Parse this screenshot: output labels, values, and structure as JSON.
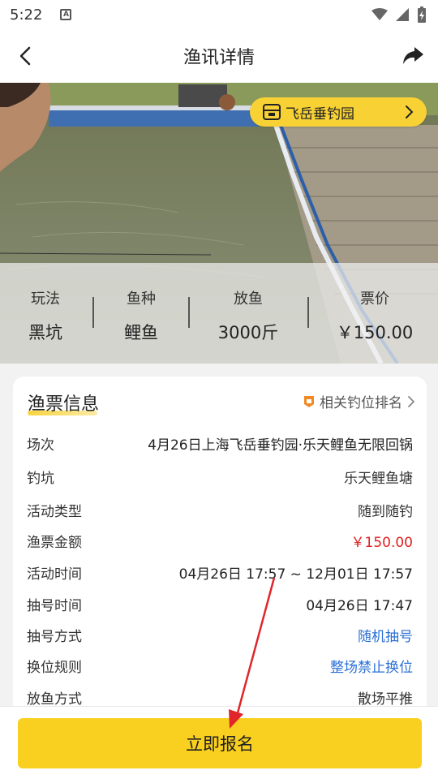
{
  "status_bar": {
    "time": "5:22",
    "icons": [
      "a-notification-icon",
      "wifi-icon",
      "signal-icon",
      "battery-charging-icon"
    ]
  },
  "header": {
    "title": "渔讯详情",
    "back_icon": "chevron-left-icon",
    "share_icon": "share-icon"
  },
  "hero": {
    "venue_name": "飞岳垂钓园",
    "venue_icon": "shop-icon",
    "stats": [
      {
        "key": "玩法",
        "value": "黑坑"
      },
      {
        "key": "鱼种",
        "value": "鲤鱼"
      },
      {
        "key": "放鱼",
        "value": "3000斤"
      },
      {
        "key": "票价",
        "value": "￥150.00"
      }
    ]
  },
  "ticket_info": {
    "title": "渔票信息",
    "rank_link": "相关钓位排名",
    "rows": [
      {
        "label": "场次",
        "value": "4月26日上海飞岳垂钓园·乐天鲤鱼无限回锅"
      },
      {
        "label": "钓坑",
        "value": "乐天鲤鱼塘"
      },
      {
        "label": "活动类型",
        "value": "随到随钓"
      },
      {
        "label": "渔票金额",
        "value": "￥150.00"
      },
      {
        "label": "活动时间",
        "value": "04月26日 17:57 ~ 12月01日 17:57"
      },
      {
        "label": "抽号时间",
        "value": "04月26日 17:47"
      },
      {
        "label": "抽号方式",
        "value": "随机抽号"
      },
      {
        "label": "换位规则",
        "value": "整场禁止换位"
      },
      {
        "label": "放鱼方式",
        "value": "散场平推"
      }
    ]
  },
  "footer": {
    "signup_label": "立即报名"
  },
  "colors": {
    "accent_yellow": "#f9d01f",
    "price_red": "#e02020",
    "link_blue": "#2a6fd6"
  }
}
